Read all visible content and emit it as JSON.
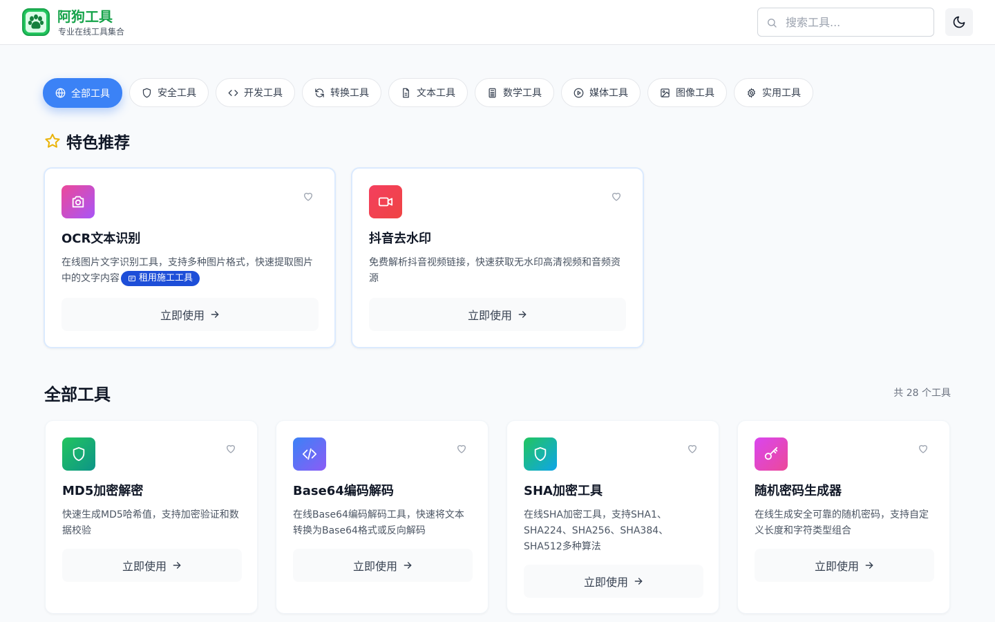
{
  "header": {
    "brand_title": "阿狗工具",
    "brand_subtitle": "专业在线工具集合",
    "search_placeholder": "搜索工具..."
  },
  "tabs": [
    {
      "label": "全部工具",
      "icon": "globe-icon",
      "active": true
    },
    {
      "label": "安全工具",
      "icon": "shield-icon",
      "active": false
    },
    {
      "label": "开发工具",
      "icon": "code-icon",
      "active": false
    },
    {
      "label": "转换工具",
      "icon": "refresh-icon",
      "active": false
    },
    {
      "label": "文本工具",
      "icon": "file-text-icon",
      "active": false
    },
    {
      "label": "数学工具",
      "icon": "calculator-icon",
      "active": false
    },
    {
      "label": "媒体工具",
      "icon": "play-circle-icon",
      "active": false
    },
    {
      "label": "图像工具",
      "icon": "image-icon",
      "active": false
    },
    {
      "label": "实用工具",
      "icon": "settings-icon",
      "active": false
    }
  ],
  "featured": {
    "title": "特色推荐",
    "cards": [
      {
        "title": "OCR文本识别",
        "description": "在线图片文字识别工具，支持多种图片格式，快速提取图片中的文字内容",
        "badge": "租用施工工具",
        "action": "立即使用",
        "icon": "camera-icon"
      },
      {
        "title": "抖音去水印",
        "description": "免费解析抖音视频链接，快速获取无水印高清视频和音频资源",
        "action": "立即使用",
        "icon": "video-icon"
      }
    ]
  },
  "all_tools": {
    "title": "全部工具",
    "count_text": "共 28 个工具",
    "cards": [
      {
        "title": "MD5加密解密",
        "description": "快速生成MD5哈希值，支持加密验证和数据校验",
        "action": "立即使用",
        "icon": "shield-icon"
      },
      {
        "title": "Base64编码解码",
        "description": "在线Base64编码解码工具，快速将文本转换为Base64格式或反向解码",
        "action": "立即使用",
        "icon": "code-icon"
      },
      {
        "title": "SHA加密工具",
        "description": "在线SHA加密工具，支持SHA1、SHA224、SHA256、SHA384、SHA512多种算法",
        "action": "立即使用",
        "icon": "shield-icon"
      },
      {
        "title": "随机密码生成器",
        "description": "在线生成安全可靠的随机密码，支持自定义长度和字符类型组合",
        "action": "立即使用",
        "icon": "key-icon"
      }
    ]
  },
  "colors": {
    "accent": "#3b82f6",
    "brand": "#16a34a",
    "badge": "#1d4ed8"
  }
}
